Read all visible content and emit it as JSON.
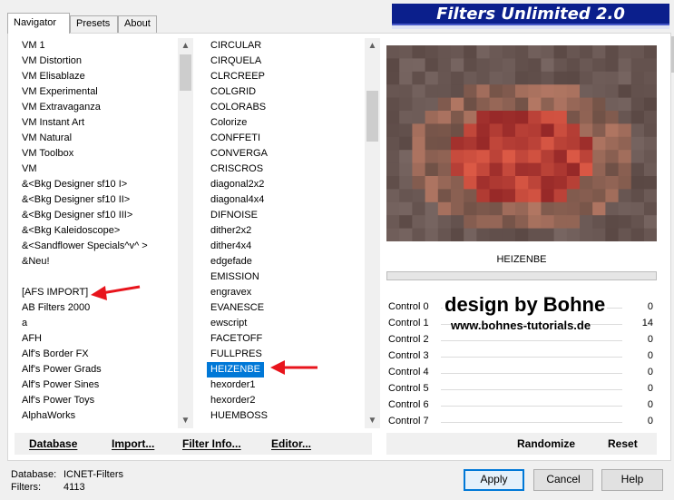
{
  "tabs": [
    {
      "label": "Navigator",
      "active": true
    },
    {
      "label": "Presets",
      "active": false
    },
    {
      "label": "About",
      "active": false
    }
  ],
  "banner_title": "Filters Unlimited 2.0",
  "categories": [
    "VM 1",
    "VM Distortion",
    "VM Elisablaze",
    "VM Experimental",
    "VM Extravaganza",
    "VM Instant Art",
    "VM Natural",
    "VM Toolbox",
    "VM",
    "&<Bkg Designer sf10 I>",
    "&<Bkg Designer sf10 II>",
    "&<Bkg Designer sf10 III>",
    "&<Bkg Kaleidoscope>",
    "&<Sandflower Specials^v^ >",
    "&Neu!",
    "",
    "[AFS IMPORT]",
    "AB Filters 2000",
    "a",
    "AFH",
    "Alf's Border FX",
    "Alf's Power Grads",
    "Alf's Power Sines",
    "Alf's Power Toys",
    "AlphaWorks"
  ],
  "filters": [
    "CIRCULAR",
    "CIRQUELA",
    "CLRCREEP",
    "COLGRID",
    "COLORABS",
    "Colorize",
    "CONFFETI",
    "CONVERGA",
    "CRISCROS",
    "diagonal2x2",
    "diagonal4x4",
    "DIFNOISE",
    "dither2x2",
    "dither4x4",
    "edgefade",
    "EMISSION",
    "engravex",
    "EVANESCE",
    "ewscript",
    "FACETOFF",
    "FULLPRES",
    "HEIZENBE",
    "hexorder1",
    "hexorder2",
    "HUEMBOSS"
  ],
  "selected_filter": "HEIZENBE",
  "left_buttons": {
    "database": "Database",
    "import": "Import...",
    "filter_info": "Filter Info...",
    "editor": "Editor..."
  },
  "preview_filter_name": "HEIZENBE",
  "watermark": {
    "line1": "design by Bohne",
    "line2": "www.bohnes-tutorials.de"
  },
  "controls": [
    {
      "label": "Control 0",
      "value": "0"
    },
    {
      "label": "Control 1",
      "value": "14"
    },
    {
      "label": "Control 2",
      "value": "0"
    },
    {
      "label": "Control 3",
      "value": "0"
    },
    {
      "label": "Control 4",
      "value": "0"
    },
    {
      "label": "Control 5",
      "value": "0"
    },
    {
      "label": "Control 6",
      "value": "0"
    },
    {
      "label": "Control 7",
      "value": "0"
    }
  ],
  "right_buttons": {
    "randomize": "Randomize",
    "reset": "Reset"
  },
  "status": {
    "database_label": "Database:",
    "database_value": "ICNET-Filters",
    "filters_label": "Filters:",
    "filters_value": "4113"
  },
  "dialog_buttons": {
    "apply": "Apply",
    "cancel": "Cancel",
    "help": "Help"
  },
  "colors": {
    "selection": "#0078d7",
    "banner": "#0b1f8c",
    "arrow": "#e8141c"
  }
}
